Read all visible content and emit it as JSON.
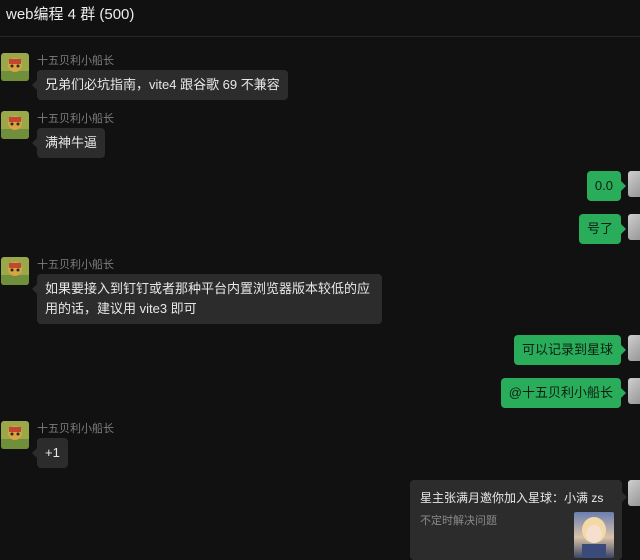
{
  "header": {
    "title": "web编程 4 群 (500)"
  },
  "messages": [
    {
      "sender": "十五贝利小船长",
      "text": "兄弟们必坑指南，vite4 跟谷歌 69 不兼容"
    },
    {
      "sender": "十五贝利小船长",
      "text": "满神牛逼"
    },
    {
      "text": "0.0"
    },
    {
      "text": "号了"
    },
    {
      "sender": "十五贝利小船长",
      "text": "如果要接入到钉钉或者那种平台内置浏览器版本较低的应用的话，建议用 vite3 即可"
    },
    {
      "text": "可以记录到星球"
    },
    {
      "text": "@十五贝利小船长"
    },
    {
      "sender": "十五贝利小船长",
      "text": "+1"
    }
  ],
  "card": {
    "title": "星主张满月邀你加入星球：小满 zs",
    "subtitle": "不定时解决问题"
  },
  "icons": {
    "incoming_avatar": "game-character-avatar",
    "outgoing_avatar": "user-avatar",
    "card_thumb": "anime-girl-thumbnail"
  }
}
